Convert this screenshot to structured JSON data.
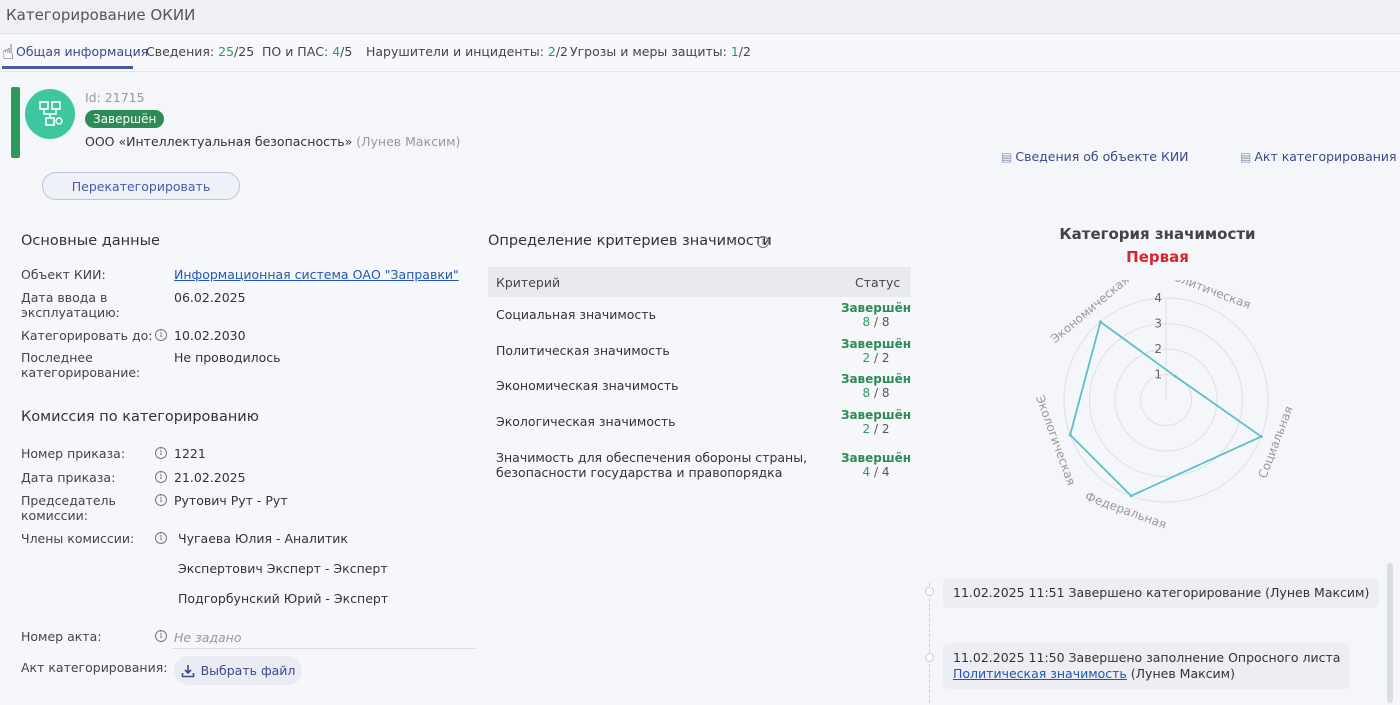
{
  "window": {
    "title": "Категорирование ОКИИ"
  },
  "tabs": [
    {
      "label": "Общая информация",
      "done": "",
      "total": ""
    },
    {
      "label": "Сведения:",
      "done": "25",
      "total": "/25"
    },
    {
      "label": "ПО и ПАС:",
      "done": "4",
      "total": "/5"
    },
    {
      "label": "Нарушители и инциденты:",
      "done": "2",
      "total": "/2"
    },
    {
      "label": "Угрозы и меры защиты:",
      "done": "1",
      "total": "/2"
    }
  ],
  "object": {
    "id": "Id: 21715",
    "status": "Завершён",
    "org": "ООО «Интеллектуальная безопасность»",
    "user": "(Лунев Максим)",
    "recategorize_label": "Перекатегорировать",
    "color_status": "#2e8b57"
  },
  "doc_links": {
    "object_info": "Сведения об объекте КИИ",
    "act": "Акт категорирования"
  },
  "main_data": {
    "title": "Основные данные",
    "object_label": "Объект КИИ:",
    "object_value": "Информационная система ОАО \"Заправки\"",
    "date_input_label_1": "Дата ввода в",
    "date_input_label_2": "эксплуатацию:",
    "date_input_value": "06.02.2025",
    "categorize_until_label": "Категорировать до:",
    "categorize_until_value": "10.02.2030",
    "last_cat_label_1": "Последнее",
    "last_cat_label_2": "категорирование:",
    "last_cat_value": "Не проводилось"
  },
  "commission": {
    "title": "Комиссия по категорированию",
    "order_no_label": "Номер приказа:",
    "order_no_value": "1221",
    "order_date_label": "Дата приказа:",
    "order_date_value": "21.02.2025",
    "chair_label_1": "Председатель",
    "chair_label_2": "комиссии:",
    "chair_value": "Рутович Рут - Рут",
    "members_label": "Члены комиссии:",
    "members": [
      "Чугаева Юлия - Аналитик",
      "Экспертович Эксперт - Эксперт",
      "Подгорбунский Юрий - Эксперт"
    ],
    "act_no_label": "Номер акта:",
    "act_no_placeholder": "Не задано",
    "act_file_label": "Акт категорирования:",
    "choose_file": "Выбрать файл"
  },
  "criteria": {
    "title": "Определение критериев значимости",
    "col_criterion": "Критерий",
    "col_status": "Статус",
    "rows": [
      {
        "name1": "Социальная значимость",
        "name2": "",
        "status": "Завершён",
        "done": "8",
        "total": " / 8"
      },
      {
        "name1": "Политическая значимость",
        "name2": "",
        "status": "Завершён",
        "done": "2",
        "total": " / 2"
      },
      {
        "name1": "Экономическая значимость",
        "name2": "",
        "status": "Завершён",
        "done": "8",
        "total": " / 8"
      },
      {
        "name1": "Экологическая значимость",
        "name2": "",
        "status": "Завершён",
        "done": "2",
        "total": " / 2"
      },
      {
        "name1": "Значимость для обеспечения обороны страны,",
        "name2": "безопасности государства и правопорядка",
        "status": "Завершён",
        "done": "4",
        "total": " / 4"
      }
    ]
  },
  "category": {
    "title": "Категория значимости",
    "value": "Первая",
    "color_value": "#d6262b",
    "radar": {
      "axes": [
        "Политическая",
        "Социальная",
        "Федеральная",
        "Экологическая",
        "Экономическая"
      ],
      "values": [
        1,
        4,
        4,
        4,
        4
      ],
      "max": 4,
      "ticks": [
        "1",
        "2",
        "3",
        "4"
      ],
      "line_color": "#5bc0c8"
    }
  },
  "timeline": [
    {
      "text": "11.02.2025 11:51 Завершено категорирование (Лунев Максим)",
      "link": "",
      "suffix": ""
    },
    {
      "text": "11.02.2025 11:50 Завершено заполнение Опросного листа",
      "link": "Политическая значимость",
      "suffix": " (Лунев Максим)"
    }
  ]
}
